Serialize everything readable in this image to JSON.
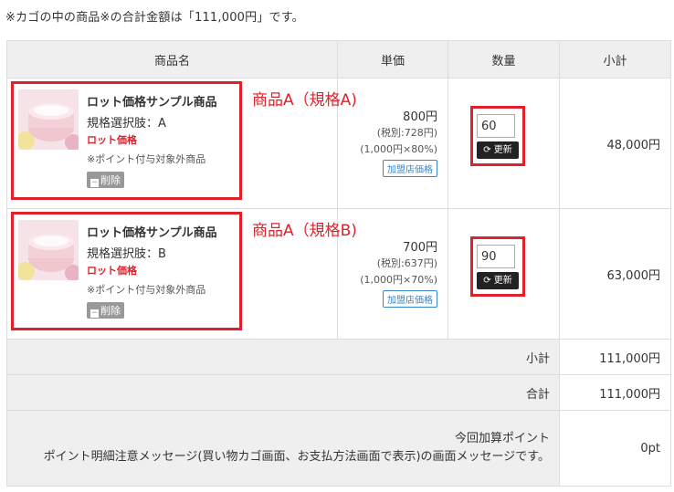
{
  "notice": "※カゴの中の商品※の合計金額は「111,000円」です。",
  "headers": [
    "商品名",
    "単価",
    "数量",
    "小計"
  ],
  "items": [
    {
      "name": "ロット価格サンプル商品",
      "spec": "規格選択肢：A",
      "lot_label": "ロット価格",
      "point_note": "※ポイント付与対象外商品",
      "delete_label": "削除",
      "annotation": "商品A（規格A)",
      "price": "800円",
      "tax": "(税別:728円)",
      "rate": "(1,000円×80%)",
      "price_tag": "加盟店価格",
      "qty": "60",
      "update_label": "更新",
      "subtotal": "48,000円"
    },
    {
      "name": "ロット価格サンプル商品",
      "spec": "規格選択肢：B",
      "lot_label": "ロット価格",
      "point_note": "※ポイント付与対象外商品",
      "delete_label": "削除",
      "annotation": "商品A（規格B)",
      "price": "700円",
      "tax": "(税別:637円)",
      "rate": "(1,000円×70%)",
      "price_tag": "加盟店価格",
      "qty": "90",
      "update_label": "更新",
      "subtotal": "63,000円"
    }
  ],
  "summary": {
    "subtotal_label": "小計",
    "subtotal_value": "111,000円",
    "total_label": "合計",
    "total_value": "111,000円",
    "points_label_1": "今回加算ポイント",
    "points_label_2": "ポイント明細注意メッセージ(買い物カゴ画面、お支払方法画面で表示)の画面メッセージです。",
    "points_value": "0pt"
  },
  "colors": {
    "accent_red": "#e0202a",
    "link_blue": "#3a86c8",
    "header_bg": "#efefef"
  }
}
